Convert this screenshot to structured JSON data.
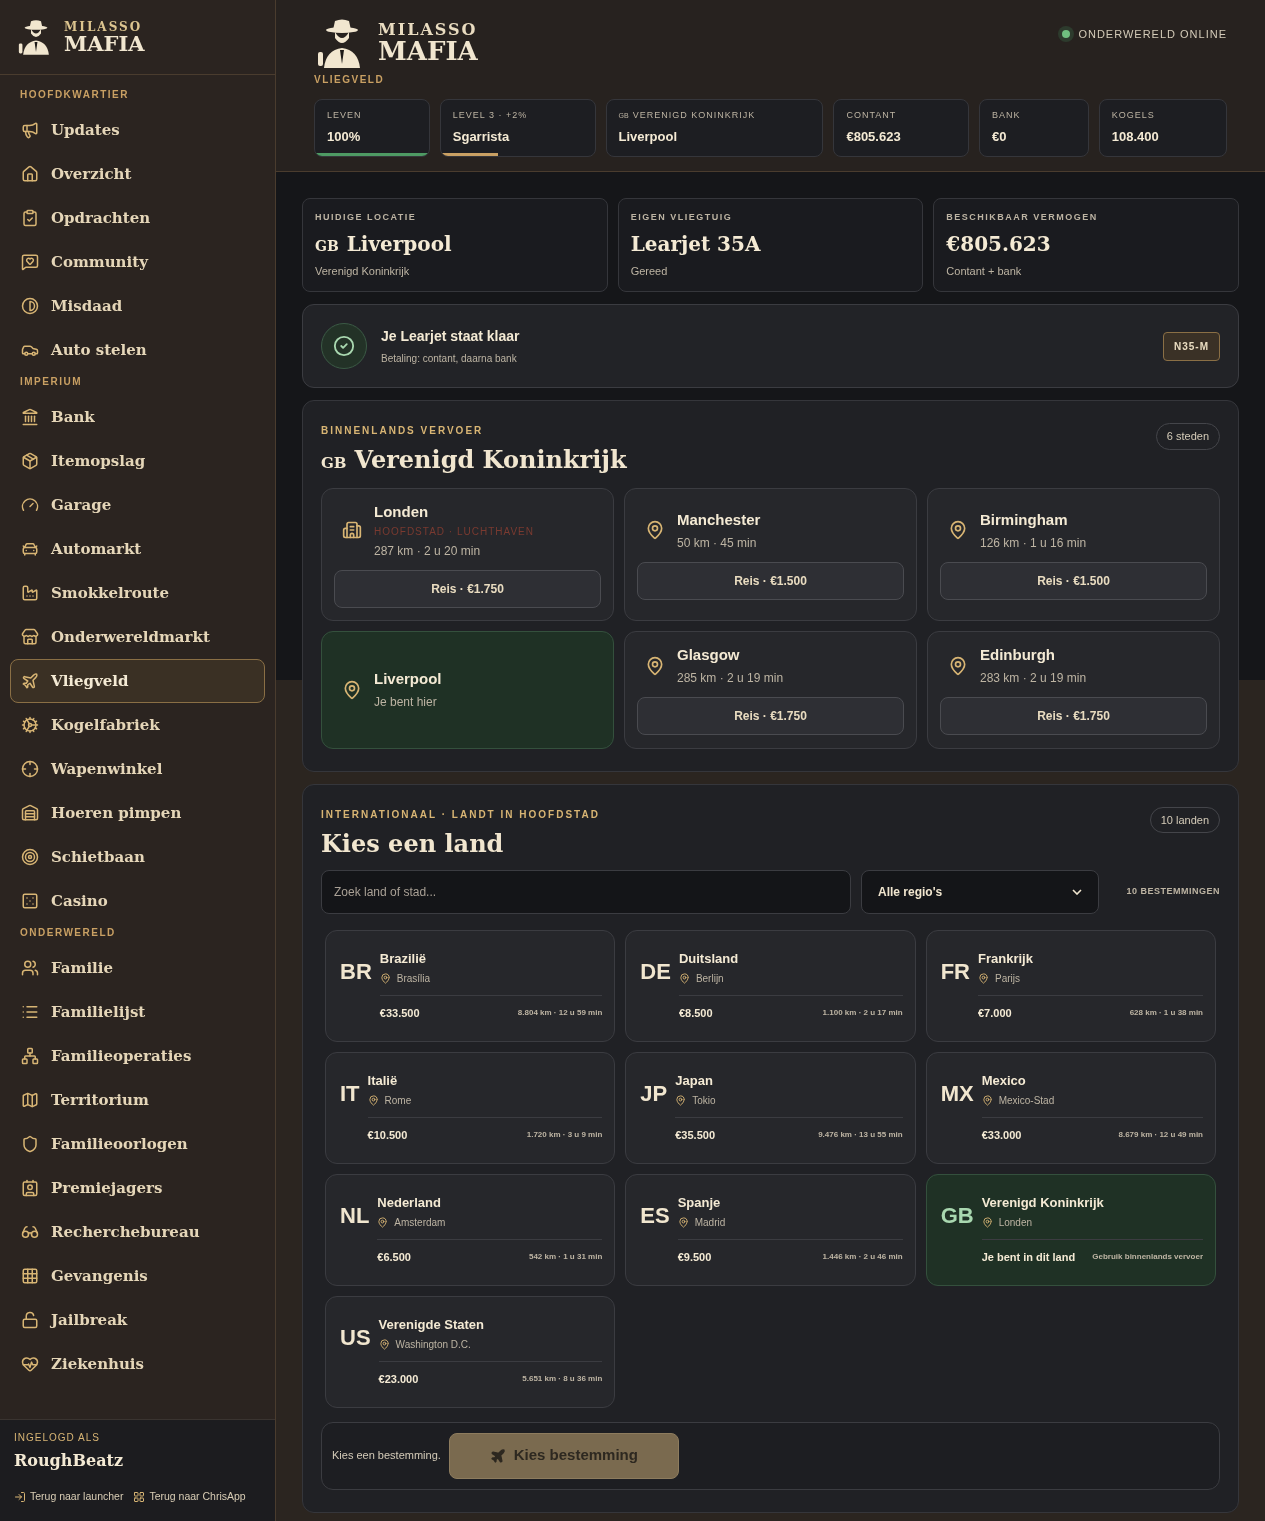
{
  "brand": {
    "line1": "MILASSO",
    "line2": "MAFIA"
  },
  "header_brand": {
    "line1": "MILASSO",
    "line2": "MAFIA"
  },
  "sidebar": {
    "sections": [
      {
        "title": "HOOFDKWARTIER",
        "items": [
          {
            "label": "Updates",
            "selected": false
          },
          {
            "label": "Overzicht",
            "selected": false
          },
          {
            "label": "Opdrachten",
            "selected": false
          },
          {
            "label": "Community",
            "selected": false
          },
          {
            "label": "Misdaad",
            "selected": false
          },
          {
            "label": "Auto stelen",
            "selected": false
          }
        ]
      },
      {
        "title": "IMPERIUM",
        "items": [
          {
            "label": "Bank",
            "selected": false
          },
          {
            "label": "Itemopslag",
            "selected": false
          },
          {
            "label": "Garage",
            "selected": false
          },
          {
            "label": "Automarkt",
            "selected": false
          },
          {
            "label": "Smokkelroute",
            "selected": false
          },
          {
            "label": "Onderwereldmarkt",
            "selected": false
          },
          {
            "label": "Vliegveld",
            "selected": true
          },
          {
            "label": "Kogelfabriek",
            "selected": false
          },
          {
            "label": "Wapenwinkel",
            "selected": false
          },
          {
            "label": "Hoeren pimpen",
            "selected": false
          },
          {
            "label": "Schietbaan",
            "selected": false
          },
          {
            "label": "Casino",
            "selected": false
          }
        ]
      },
      {
        "title": "ONDERWERELD",
        "items": [
          {
            "label": "Familie",
            "selected": false
          },
          {
            "label": "Familielijst",
            "selected": false
          },
          {
            "label": "Familieoperaties",
            "selected": false
          },
          {
            "label": "Territorium",
            "selected": false
          },
          {
            "label": "Familieoorlogen",
            "selected": false
          },
          {
            "label": "Premiejagers",
            "selected": false
          },
          {
            "label": "Recherchebureau",
            "selected": false
          },
          {
            "label": "Gevangenis",
            "selected": false
          },
          {
            "label": "Jailbreak",
            "selected": false
          },
          {
            "label": "Ziekenhuis",
            "selected": false
          }
        ]
      }
    ],
    "footer": {
      "caption": "INGELOGD ALS",
      "user": "RoughBeatz",
      "links": [
        "Terug naar launcher",
        "Terug naar ChrisApp"
      ]
    }
  },
  "header": {
    "page": "VLIEGVELD",
    "status": "ONDERWERELD ONLINE",
    "online": true,
    "stats": [
      {
        "label": "LEVEN",
        "value": "100%",
        "level": 1,
        "color": "#4e9a63"
      },
      {
        "label": "LEVEL 3 · +2%",
        "value": "Sgarrista",
        "level": 0.37,
        "color": "#c9a063"
      },
      {
        "flag": "GB",
        "label": "VERENIGD KONINKRIJK",
        "value": "Liverpool"
      },
      {
        "label": "CONTANT",
        "value": "€805.623"
      },
      {
        "label": "BANK",
        "value": "€0"
      },
      {
        "label": "KOGELS",
        "value": "108.400"
      }
    ]
  },
  "summary": [
    {
      "label": "HUIDIGE LOCATIE",
      "flag": "GB",
      "value": "Liverpool",
      "sub": "Verenigd Koninkrijk"
    },
    {
      "label": "EIGEN VLIEGTUIG",
      "value": "Learjet 35A",
      "sub": "Gereed"
    },
    {
      "label": "BESCHIKBAAR VERMOGEN",
      "value": "€805.623",
      "sub": "Contant + bank"
    }
  ],
  "ready": {
    "title": "Je Learjet staat klaar",
    "sub": "Betaling: contant, daarna bank",
    "tail": "N35-M"
  },
  "domestic": {
    "kicker": "BINNENLANDS VERVOER",
    "flag": "GB",
    "title": "Verenigd Koninkrijk",
    "count": "6 steden",
    "cities": [
      {
        "kind": "capital",
        "name": "Londen",
        "tag": "HOOFDSTAD · LUCHTHAVEN",
        "info": "287 km · 2 u 20 min",
        "button": "Reis · €1.750"
      },
      {
        "kind": "normal",
        "name": "Manchester",
        "info": "50 km · 45 min",
        "button": "Reis · €1.500"
      },
      {
        "kind": "normal",
        "name": "Birmingham",
        "info": "126 km · 1 u 16 min",
        "button": "Reis · €1.500"
      },
      {
        "kind": "current",
        "name": "Liverpool",
        "info": "Je bent hier"
      },
      {
        "kind": "normal",
        "name": "Glasgow",
        "info": "285 km · 2 u 19 min",
        "button": "Reis · €1.750"
      },
      {
        "kind": "normal",
        "name": "Edinburgh",
        "info": "283 km · 2 u 19 min",
        "button": "Reis · €1.750"
      }
    ]
  },
  "international": {
    "kicker": "INTERNATIONAAL · LANDT IN HOOFDSTAD",
    "title": "Kies een land",
    "count": "10 landen",
    "search": {
      "placeholder": "Zoek land of stad..."
    },
    "region": "Alle regio's",
    "results": "10 BESTEMMINGEN",
    "countries": [
      {
        "code": "BR",
        "name": "Brazilië",
        "city": "Brasília",
        "price": "€33.500",
        "info": "8.804 km · 12 u 59 min",
        "current": false
      },
      {
        "code": "DE",
        "name": "Duitsland",
        "city": "Berlijn",
        "price": "€8.500",
        "info": "1.100 km · 2 u 17 min",
        "current": false
      },
      {
        "code": "FR",
        "name": "Frankrijk",
        "city": "Parijs",
        "price": "€7.000",
        "info": "628 km · 1 u 38 min",
        "current": false
      },
      {
        "code": "IT",
        "name": "Italië",
        "city": "Rome",
        "price": "€10.500",
        "info": "1.720 km · 3 u 9 min",
        "current": false
      },
      {
        "code": "JP",
        "name": "Japan",
        "city": "Tokio",
        "price": "€35.500",
        "info": "9.476 km · 13 u 55 min",
        "current": false
      },
      {
        "code": "MX",
        "name": "Mexico",
        "city": "Mexico-Stad",
        "price": "€33.000",
        "info": "8.679 km · 12 u 49 min",
        "current": false
      },
      {
        "code": "NL",
        "name": "Nederland",
        "city": "Amsterdam",
        "price": "€6.500",
        "info": "542 km · 1 u 31 min",
        "current": false
      },
      {
        "code": "ES",
        "name": "Spanje",
        "city": "Madrid",
        "price": "€9.500",
        "info": "1.446 km · 2 u 46 min",
        "current": false
      },
      {
        "code": "GB",
        "name": "Verenigd Koninkrijk",
        "city": "Londen",
        "price": "Je bent in dit land",
        "info": "Gebruik binnenlands vervoer",
        "current": true
      },
      {
        "code": "US",
        "name": "Verenigde Staten",
        "city": "Washington D.C.",
        "price": "€23.000",
        "info": "5.651 km · 8 u 36 min",
        "current": false
      }
    ],
    "footer": {
      "hint": "Kies een bestemming.",
      "button": "Kies bestemming",
      "disabled": true
    }
  }
}
